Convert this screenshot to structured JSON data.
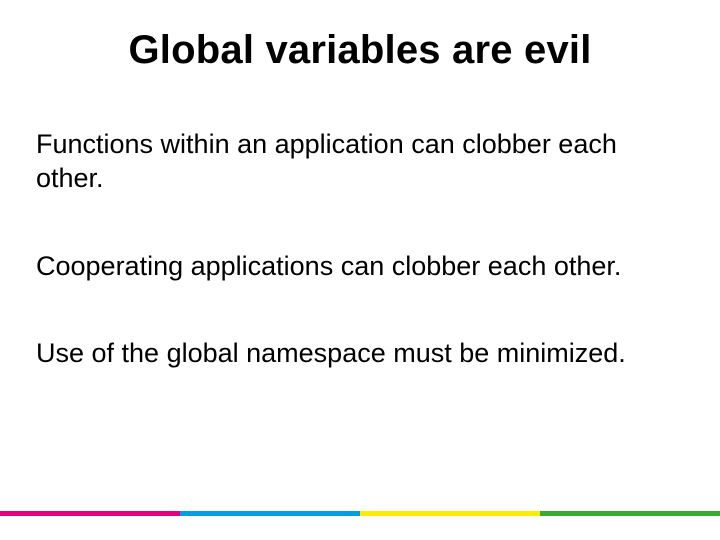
{
  "slide": {
    "title": "Global variables are evil",
    "points": [
      "Functions within an application can clobber each other.",
      "Cooperating applications can clobber each other.",
      "Use of the global namespace must be minimized."
    ]
  },
  "footer_colors": [
    "#e6007e",
    "#009fe3",
    "#ffed00",
    "#3aaa35"
  ]
}
